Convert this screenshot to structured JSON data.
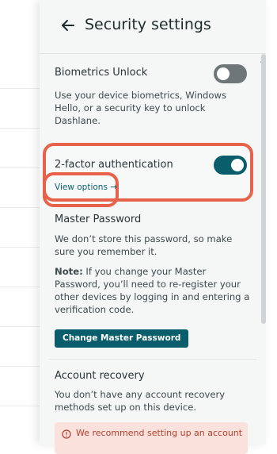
{
  "panel": {
    "title": "Security settings"
  },
  "biometrics": {
    "label": "Biometrics Unlock",
    "description": "Use your device biometrics, Windows Hello, or a security key to unlock Dashlane.",
    "toggle_on": false
  },
  "two_factor": {
    "label": "2-factor authentication",
    "toggle_on": true,
    "link_label": "View options →"
  },
  "master_password": {
    "label": "Master Password",
    "description": "We don’t store this password, so make sure you remember it.",
    "note_label": "Note:",
    "note_text": " If you change your Master Password, you’ll need to re-register your other devices by logging in and entering a verification code.",
    "button_label": "Change Master Password"
  },
  "account_recovery": {
    "label": "Account recovery",
    "description": "You don’t have any account recovery methods set up on this device.",
    "alert_text": "We recommend setting up an account"
  },
  "colors": {
    "accent": "#0a5e6b",
    "highlight": "#e8614a",
    "alert_bg": "#fbe1dc"
  },
  "icons": {
    "back": "arrow-left-icon",
    "alert": "info-circle-icon"
  }
}
